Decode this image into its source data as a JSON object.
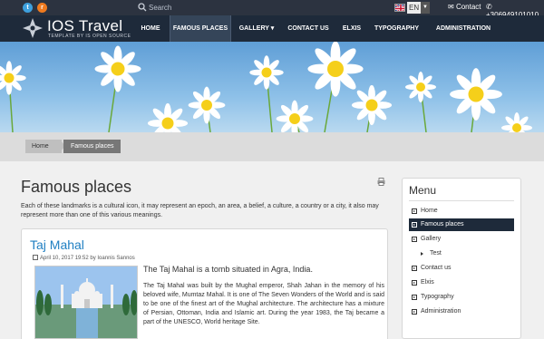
{
  "topbar": {
    "social": [
      "twitter-icon",
      "rss-icon"
    ],
    "search_placeholder": "Search",
    "language": "EN",
    "contact_label": "Contact",
    "phone": "+306949101010"
  },
  "header": {
    "brand": "IOS Travel",
    "tagline": "TEMPLATE BY IS OPEN SOURCE",
    "nav": [
      {
        "label": "HOME"
      },
      {
        "label": "FAMOUS PLACES",
        "active": true
      },
      {
        "label": "GALLERY ▾"
      },
      {
        "label": "CONTACT US"
      },
      {
        "label": "ELXIS"
      },
      {
        "label": "TYPOGRAPHY"
      },
      {
        "label": "ADMINISTRATION"
      }
    ]
  },
  "breadcrumb": {
    "home": "Home",
    "current": "Famous places"
  },
  "main": {
    "title": "Famous places",
    "intro": "Each of these landmarks is a cultural icon, it may represent an epoch, an area, a belief, a culture, a country or a city, it also may represent more than one of this various meanings.",
    "article": {
      "title": "Taj Mahal",
      "date": "April 10, 2017 19:52",
      "author": "by Ioannis Sannos",
      "lead": "The Taj Mahal is a tomb situated in Agra, India.",
      "body": "The Taj Mahal was built by the Mughal emperor, Shah Jahan in the memory of his beloved wife, Mumtaz Mahal. It is one of The Seven Wonders of the World and is said to be one of the finest art of the Mughal architecture. The architecture has a mixture of Persian, Ottoman, India and Islamic art. During the year 1983, the Taj became a part of the UNESCO, World heritage Site."
    }
  },
  "menu": {
    "title": "Menu",
    "items": [
      {
        "label": "Home"
      },
      {
        "label": "Famous places",
        "active": true
      },
      {
        "label": "Gallery"
      },
      {
        "label": "Test",
        "sub": true
      },
      {
        "label": "Contact us"
      },
      {
        "label": "Elxis"
      },
      {
        "label": "Typography"
      },
      {
        "label": "Administration"
      }
    ]
  },
  "colors": {
    "topbar": "#2c3340",
    "navbar": "#1e2a3a",
    "link": "#1f7fc2",
    "active_menu": "#1e2a3a"
  }
}
